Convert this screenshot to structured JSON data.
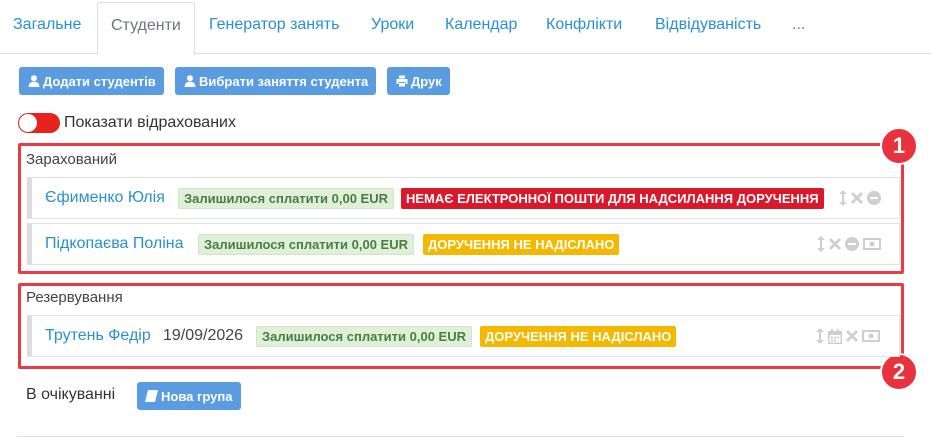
{
  "tabs": [
    {
      "label": "Загальне",
      "active": false
    },
    {
      "label": "Студенти",
      "active": true
    },
    {
      "label": "Генератор занять",
      "active": false
    },
    {
      "label": "Уроки",
      "active": false
    },
    {
      "label": "Календар",
      "active": false
    },
    {
      "label": "Конфлікти",
      "active": false
    },
    {
      "label": "Відвідуваність",
      "active": false
    },
    {
      "label": "...",
      "active": false
    }
  ],
  "toolbar": {
    "add_students": "Додати студентів",
    "choose_lessons": "Вибрати заняття студента",
    "print": "Друк"
  },
  "toggle": {
    "label": "Показати відрахованих",
    "on": false
  },
  "sections": {
    "enrolled": {
      "title": "Зарахований",
      "callout_number": "1",
      "students": [
        {
          "name": "Єфименко Юлія",
          "balance": "Залишилося сплатити 0,00 EUR",
          "status": "НЕМАЄ ЕЛЕКТРОННОЇ ПОШТИ ДЛЯ НАДСИЛАННЯ ДОРУЧЕННЯ",
          "status_color": "#d9182b"
        },
        {
          "name": "Підкопаєва Поліна",
          "balance": "Залишилося сплатити 0,00 EUR",
          "status": "ДОРУЧЕННЯ НЕ НАДІСЛАНО",
          "status_color": "#f5b800"
        }
      ]
    },
    "reserved": {
      "title": "Резервування",
      "callout_number": "2",
      "students": [
        {
          "name": "Трутень Федір",
          "date": "19/09/2026",
          "balance": "Залишилося сплатити 0,00 EUR",
          "status": "ДОРУЧЕННЯ НЕ НАДІСЛАНО",
          "status_color": "#f5b800"
        }
      ]
    },
    "waiting": {
      "title": "В очікуванні",
      "new_group_label": "Нова група"
    }
  },
  "colors": {
    "link": "#2a8fd0",
    "primary_button": "#5b9be0",
    "highlight_border": "#e83b45",
    "toggle_off": "#e8231d",
    "balance_badge_bg": "#dff0d8"
  }
}
